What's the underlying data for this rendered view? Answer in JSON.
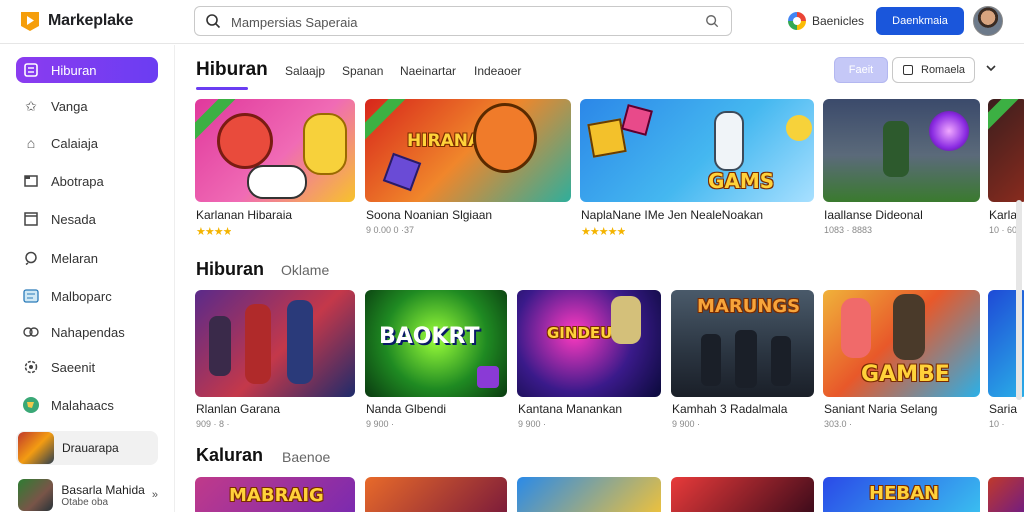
{
  "app": {
    "name": "Markeplake"
  },
  "search": {
    "placeholder": "Mampersias Saperaia"
  },
  "header": {
    "games_label": "Baenicles",
    "primary_button": "Daenkmaia"
  },
  "sidebar": {
    "items": [
      {
        "label": "Hiburan",
        "icon": "grid-icon",
        "active": true
      },
      {
        "label": "Vanga",
        "icon": "star-icon"
      },
      {
        "label": "Calaiaja",
        "icon": "home-icon"
      },
      {
        "label": "Abotrapa",
        "icon": "folder-icon"
      },
      {
        "label": "Nesada",
        "icon": "square-icon"
      },
      {
        "label": "Melaran",
        "icon": "search-icon"
      },
      {
        "label": "Malboparc",
        "icon": "tag-icon"
      },
      {
        "label": "Nahapendas",
        "icon": "users-icon"
      },
      {
        "label": "Saeenit",
        "icon": "gear-icon"
      },
      {
        "label": "Malahaacs",
        "icon": "globe-icon"
      }
    ],
    "cards": [
      {
        "title": "Drauarapa",
        "subtitle": ""
      },
      {
        "title": "Basarla Mahida",
        "subtitle": "Otabe oba"
      }
    ]
  },
  "tabs": {
    "main": "Hiburan",
    "items": [
      "Salaajp",
      "Spanan",
      "Naeinartar",
      "Indeaoer"
    ],
    "filter_button": "Faeit",
    "filter_button2": "Romaela"
  },
  "sections": [
    {
      "title": "",
      "subtitle": "",
      "cards": [
        {
          "title": "Karlanan Hibaraia",
          "meta": "★★★★",
          "art": "",
          "rating": 4
        },
        {
          "title": "Soona Noanian Slgiaan",
          "meta": "9 0.00 0 ·37",
          "art": "HIRANAN"
        },
        {
          "title": "NaplaNane IMe Jen NealeNoakan",
          "meta": "★★★★★",
          "art": "GAMS",
          "rating": 5
        },
        {
          "title": "Iaallanse Dideonal",
          "meta": "1083 · 8883",
          "art": ""
        },
        {
          "title": "Karla",
          "meta": "10 · 60",
          "art": ""
        }
      ]
    },
    {
      "title": "Hiburan",
      "subtitle": "Oklame",
      "cards": [
        {
          "title": "Rlanlan Garana",
          "meta": "909 · 8 ·",
          "art": ""
        },
        {
          "title": "Nanda Glbendi",
          "meta": "9 900 ·",
          "art": "BAOKRT"
        },
        {
          "title": "Kantana Manankan",
          "meta": "9 900 ·",
          "art": "GINDEUR"
        },
        {
          "title": "Kamhah 3 Radalmala",
          "meta": "9 900 ·",
          "art": "MARUNGS"
        },
        {
          "title": "Saniant Naria Selang",
          "meta": "303.0 ·",
          "art": "GAMBE"
        },
        {
          "title": "Saria",
          "meta": "10 ·",
          "art": ""
        }
      ]
    },
    {
      "title": "Kaluran",
      "subtitle": "Baenoe",
      "cards": [
        {
          "title": "",
          "meta": "",
          "art": "MABRAIG"
        },
        {
          "title": "",
          "meta": "",
          "art": ""
        },
        {
          "title": "",
          "meta": "",
          "art": ""
        },
        {
          "title": "",
          "meta": "",
          "art": ""
        },
        {
          "title": "",
          "meta": "",
          "art": "HEBAN"
        },
        {
          "title": "",
          "meta": "",
          "art": ""
        }
      ]
    }
  ],
  "colors": {
    "accent": "#6b3df2",
    "primary": "#1a56db",
    "star": "#f4b400"
  }
}
